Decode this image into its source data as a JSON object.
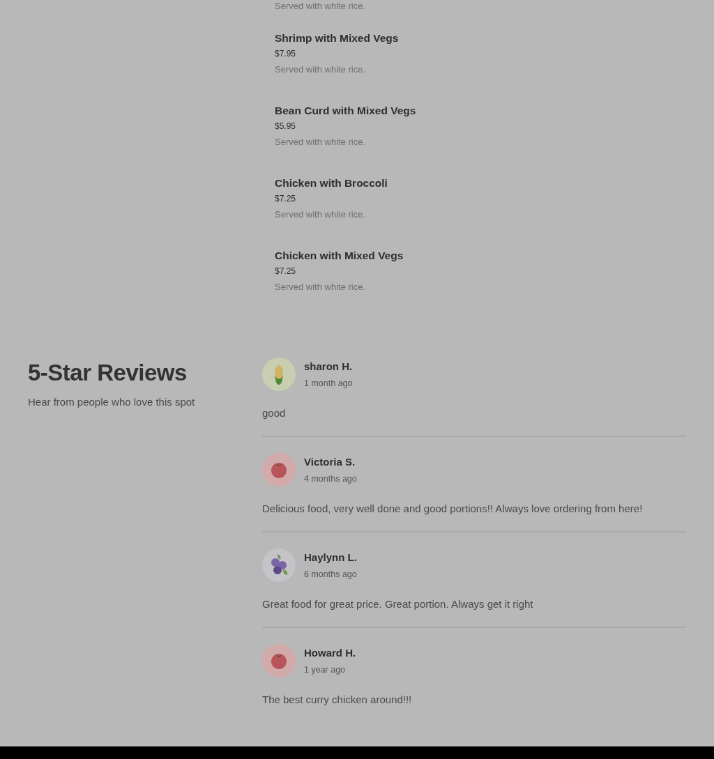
{
  "menu": {
    "cut_note": "Served with white rice.",
    "items": [
      {
        "name": "Shrimp with Mixed Vegs",
        "price": "$7.95",
        "description": "Served with white rice."
      },
      {
        "name": "Bean Curd with Mixed Vegs",
        "price": "$5.95",
        "description": "Served with white rice."
      },
      {
        "name": "Chicken with Broccoli",
        "price": "$7.25",
        "description": "Served with white rice."
      },
      {
        "name": "Chicken with Mixed Vegs",
        "price": "$7.25",
        "description": "Served with white rice."
      }
    ]
  },
  "reviews_section": {
    "title": "5-Star Reviews",
    "subtitle": "Hear from people who love this spot",
    "reviews": [
      {
        "name": "sharon H.",
        "time": "1 month ago",
        "text": "good",
        "avatar": {
          "kind": "corn"
        }
      },
      {
        "name": "Victoria S.",
        "time": "4 months ago",
        "text": "Delicious food, very well done and good portions!! Always love ordering from here!",
        "avatar": {
          "kind": "tomato"
        }
      },
      {
        "name": "Haylynn L.",
        "time": "6 months ago",
        "text": "Great food for great price. Great portion. Always get it right",
        "avatar": {
          "kind": "berries"
        }
      },
      {
        "name": "Howard H.",
        "time": "1 year ago",
        "text": "The best curry chicken around!!!",
        "avatar": {
          "kind": "tomato"
        }
      }
    ]
  }
}
